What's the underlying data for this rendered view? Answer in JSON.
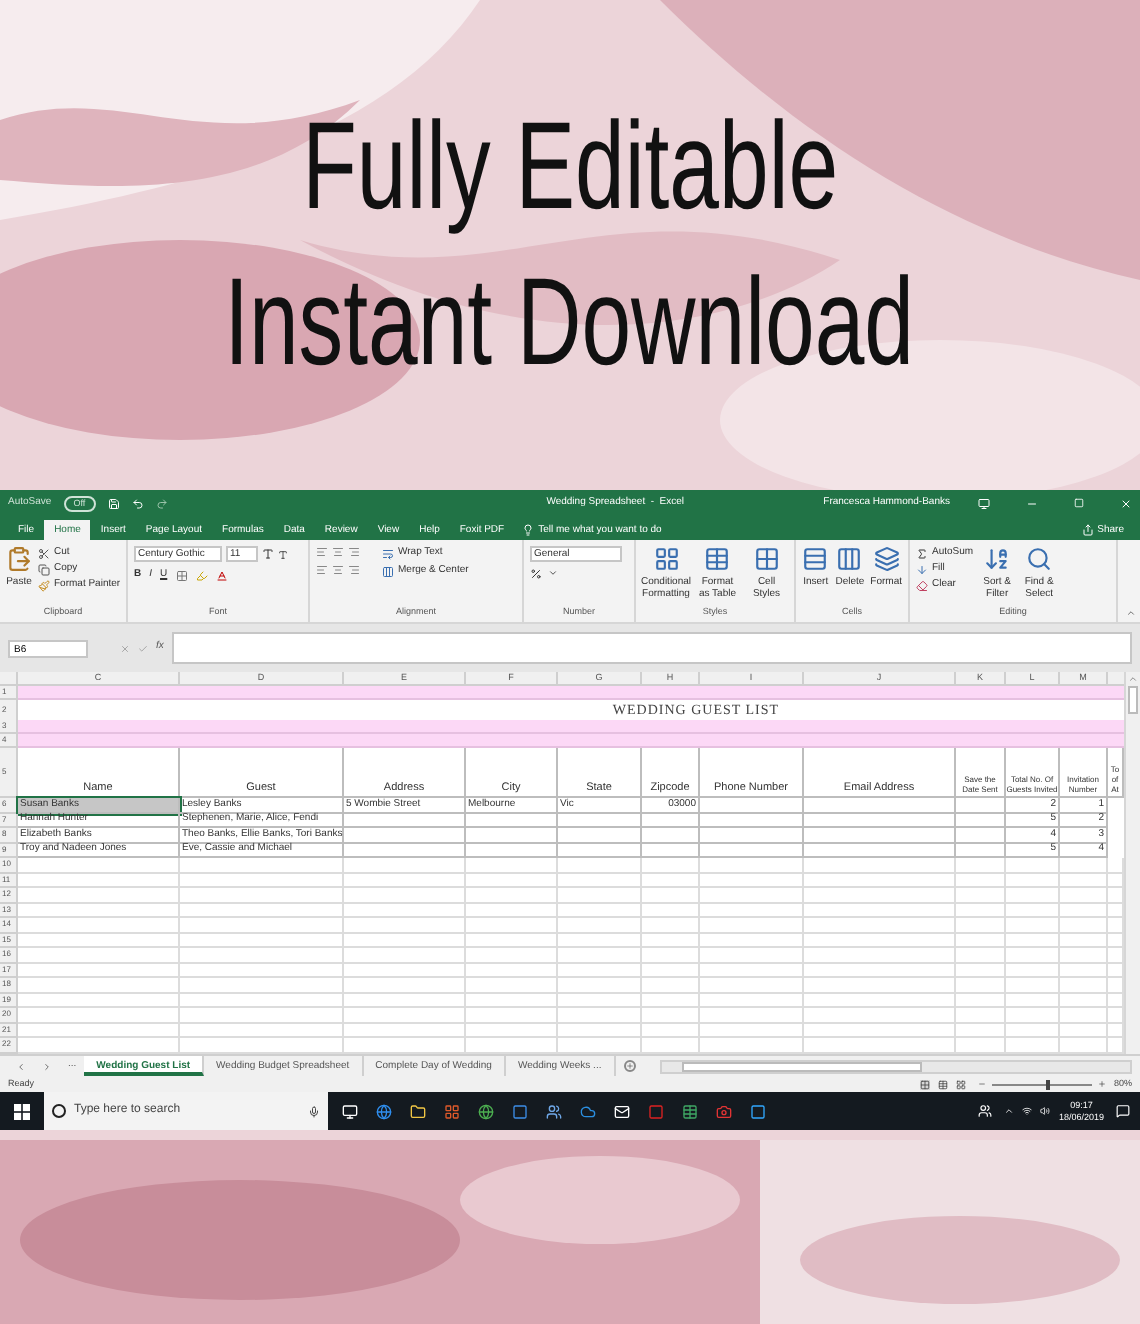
{
  "headline": {
    "line_1": "Fully Editable",
    "line_2": "Instant Download"
  },
  "title_bar": {
    "autosave": "AutoSave",
    "autosave_on": false,
    "autosave_state": "Off",
    "title": "Wedding Spreadsheet  -  Excel",
    "user": "Francesca Hammond-Banks"
  },
  "ribbon_tabs": [
    {
      "label": "File",
      "selected": false
    },
    {
      "label": "Home",
      "selected": true
    },
    {
      "label": "Insert",
      "selected": false
    },
    {
      "label": "Page Layout",
      "selected": false
    },
    {
      "label": "Formulas",
      "selected": false
    },
    {
      "label": "Data",
      "selected": false
    },
    {
      "label": "Review",
      "selected": false
    },
    {
      "label": "View",
      "selected": false
    },
    {
      "label": "Help",
      "selected": false
    },
    {
      "label": "Foxit PDF",
      "selected": false
    }
  ],
  "tell_me": "Tell me what you want to do",
  "share": "Share",
  "ribbon": {
    "clipboard": {
      "paste": "Paste",
      "cut": "Cut",
      "copy": "Copy",
      "format_painter": "Format Painter",
      "label": "Clipboard"
    },
    "font": {
      "name": "Century Gothic",
      "size": "11",
      "bold": "B",
      "italic": "I",
      "underline": "U",
      "label": "Font"
    },
    "alignment": {
      "wrap_text": "Wrap Text",
      "merge": "Merge & Center",
      "label": "Alignment"
    },
    "number": {
      "format": "General",
      "label": "Number"
    },
    "styles": {
      "buttons": [
        "Conditional Formatting",
        "Format as Table",
        "Cell Styles"
      ],
      "label": "Styles"
    },
    "cells": {
      "buttons": [
        "Insert",
        "Delete",
        "Format"
      ],
      "label": "Cells"
    },
    "editing": {
      "autosum": "AutoSum",
      "fill": "Fill",
      "clear": "Clear",
      "buttons": [
        "Sort & Filter",
        "Find & Select"
      ],
      "label": "Editing"
    }
  },
  "formula_bar": {
    "name_box": "B6",
    "fx": "fx"
  },
  "columns": [
    "C",
    "D",
    "E",
    "F",
    "G",
    "H",
    "I",
    "J",
    "K",
    "L",
    "M"
  ],
  "rows": [
    {
      "number": "1",
      "kind": "band"
    },
    {
      "number": "2",
      "kind": "title",
      "text": "WEDDING GUEST LIST"
    },
    {
      "number": "3",
      "kind": "band"
    },
    {
      "number": "4",
      "kind": "band"
    },
    {
      "number": "5",
      "kind": "header",
      "cells": [
        "Name",
        "Guest",
        "Address",
        "City",
        "State",
        "Zipcode",
        "Phone Number",
        "Email Address",
        "Save the Date Sent",
        "Total No. Of Guests Invited",
        "Invitation Number",
        "To of At"
      ]
    },
    {
      "number": "6",
      "kind": "data",
      "cells": [
        {
          "kind": "text",
          "text": "Susan Banks",
          "selected": true
        },
        {
          "kind": "text",
          "text": "Lesley Banks",
          "selected": false
        },
        {
          "kind": "text",
          "text": "5 Wombie Street",
          "selected": false
        },
        {
          "kind": "text",
          "text": "Melbourne",
          "selected": false
        },
        {
          "kind": "text",
          "text": "Vic",
          "selected": false
        },
        {
          "kind": "number",
          "text": "03000",
          "selected": false
        },
        {
          "kind": "empty",
          "selected": false
        },
        {
          "kind": "empty",
          "selected": false
        },
        {
          "kind": "empty",
          "selected": false
        },
        {
          "kind": "number",
          "text": "2",
          "selected": false
        },
        {
          "kind": "number",
          "text": "1",
          "selected": false
        }
      ]
    },
    {
      "number": "7",
      "kind": "data",
      "cells": [
        {
          "kind": "text",
          "text": "Hannah Hunter",
          "selected": false
        },
        {
          "kind": "text",
          "text": "Stephenen, Marie, Alice, Fendi",
          "selected": false
        },
        {
          "kind": "empty",
          "selected": false
        },
        {
          "kind": "empty",
          "selected": false
        },
        {
          "kind": "empty",
          "selected": false
        },
        {
          "kind": "empty",
          "selected": false
        },
        {
          "kind": "empty",
          "selected": false
        },
        {
          "kind": "empty",
          "selected": false
        },
        {
          "kind": "empty",
          "selected": false
        },
        {
          "kind": "number",
          "text": "5",
          "selected": false
        },
        {
          "kind": "number",
          "text": "2",
          "selected": false
        }
      ]
    },
    {
      "number": "8",
      "kind": "data",
      "cells": [
        {
          "kind": "text",
          "text": "Elizabeth Banks",
          "selected": false
        },
        {
          "kind": "text",
          "text": "Theo Banks, Ellie Banks, Tori Banks",
          "selected": false
        },
        {
          "kind": "empty",
          "selected": false
        },
        {
          "kind": "empty",
          "selected": false
        },
        {
          "kind": "empty",
          "selected": false
        },
        {
          "kind": "empty",
          "selected": false
        },
        {
          "kind": "empty",
          "selected": false
        },
        {
          "kind": "empty",
          "selected": false
        },
        {
          "kind": "empty",
          "selected": false
        },
        {
          "kind": "number",
          "text": "4",
          "selected": false
        },
        {
          "kind": "number",
          "text": "3",
          "selected": false
        }
      ]
    },
    {
      "number": "9",
      "kind": "data",
      "cells": [
        {
          "kind": "text",
          "text": "Troy and Nadeen Jones",
          "selected": false
        },
        {
          "kind": "text",
          "text": "Eve, Cassie and Michael",
          "selected": false
        },
        {
          "kind": "empty",
          "selected": false
        },
        {
          "kind": "empty",
          "selected": false
        },
        {
          "kind": "empty",
          "selected": false
        },
        {
          "kind": "empty",
          "selected": false
        },
        {
          "kind": "empty",
          "selected": false
        },
        {
          "kind": "empty",
          "selected": false
        },
        {
          "kind": "empty",
          "selected": false
        },
        {
          "kind": "number",
          "text": "5",
          "selected": false
        },
        {
          "kind": "number",
          "text": "4",
          "selected": false
        }
      ]
    },
    {
      "number": "10",
      "kind": "empty"
    },
    {
      "number": "11",
      "kind": "empty"
    },
    {
      "number": "12",
      "kind": "empty"
    },
    {
      "number": "13",
      "kind": "empty"
    },
    {
      "number": "14",
      "kind": "empty"
    },
    {
      "number": "15",
      "kind": "empty"
    },
    {
      "number": "16",
      "kind": "empty"
    },
    {
      "number": "17",
      "kind": "empty"
    },
    {
      "number": "18",
      "kind": "empty"
    },
    {
      "number": "19",
      "kind": "empty"
    },
    {
      "number": "20",
      "kind": "empty"
    },
    {
      "number": "21",
      "kind": "empty"
    },
    {
      "number": "22",
      "kind": "empty"
    }
  ],
  "sheet_nav_more": "...",
  "sheet_tabs": [
    {
      "label": "Wedding Guest List",
      "selected": true
    },
    {
      "label": "Wedding Budget Spreadsheet",
      "selected": false
    },
    {
      "label": "Complete Day of Wedding",
      "selected": false
    },
    {
      "label": "Wedding Weeks ...",
      "selected": false
    }
  ],
  "status_bar": {
    "status": "Ready",
    "zoom": "80%",
    "zoom_slider": {
      "level": 0.55
    }
  },
  "taskbar": {
    "search_placeholder": "Type here to search",
    "time": "09:17",
    "date": "18/06/2019"
  }
}
